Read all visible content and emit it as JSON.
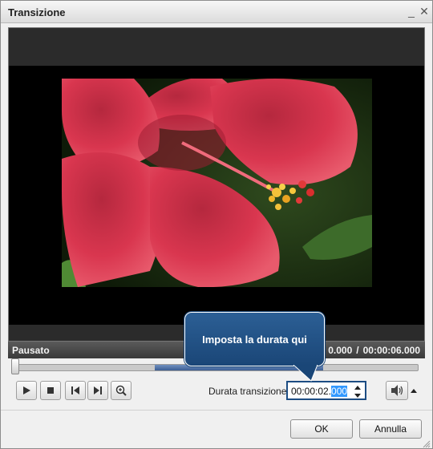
{
  "window": {
    "title": "Transizione",
    "minimize_glyph": "_",
    "close_glyph": "✕"
  },
  "player": {
    "status": "Pausato",
    "current_time_visible": "0.000",
    "time_separator": "/",
    "total_time": "00:00:06.000",
    "timeline_position_fraction": 0.0,
    "transition_range_fraction": [
      0.35,
      0.76
    ]
  },
  "controls": {
    "play_icon": "play-icon",
    "stop_icon": "stop-icon",
    "prev_icon": "previous-icon",
    "next_icon": "next-icon",
    "zoom_icon": "zoom-in-icon"
  },
  "duration": {
    "label": "Durata transizione:",
    "value_main": "00:00:02.",
    "value_selected": "000"
  },
  "volume": {
    "icon": "speaker-icon",
    "arrow_icon": "triangle-up-icon"
  },
  "callout": {
    "text": "Imposta la durata qui"
  },
  "buttons": {
    "ok": "OK",
    "cancel": "Annulla"
  },
  "colors": {
    "callout_bg": "#1f4f82",
    "status_bar": "#444444",
    "selection": "#3399ff"
  }
}
